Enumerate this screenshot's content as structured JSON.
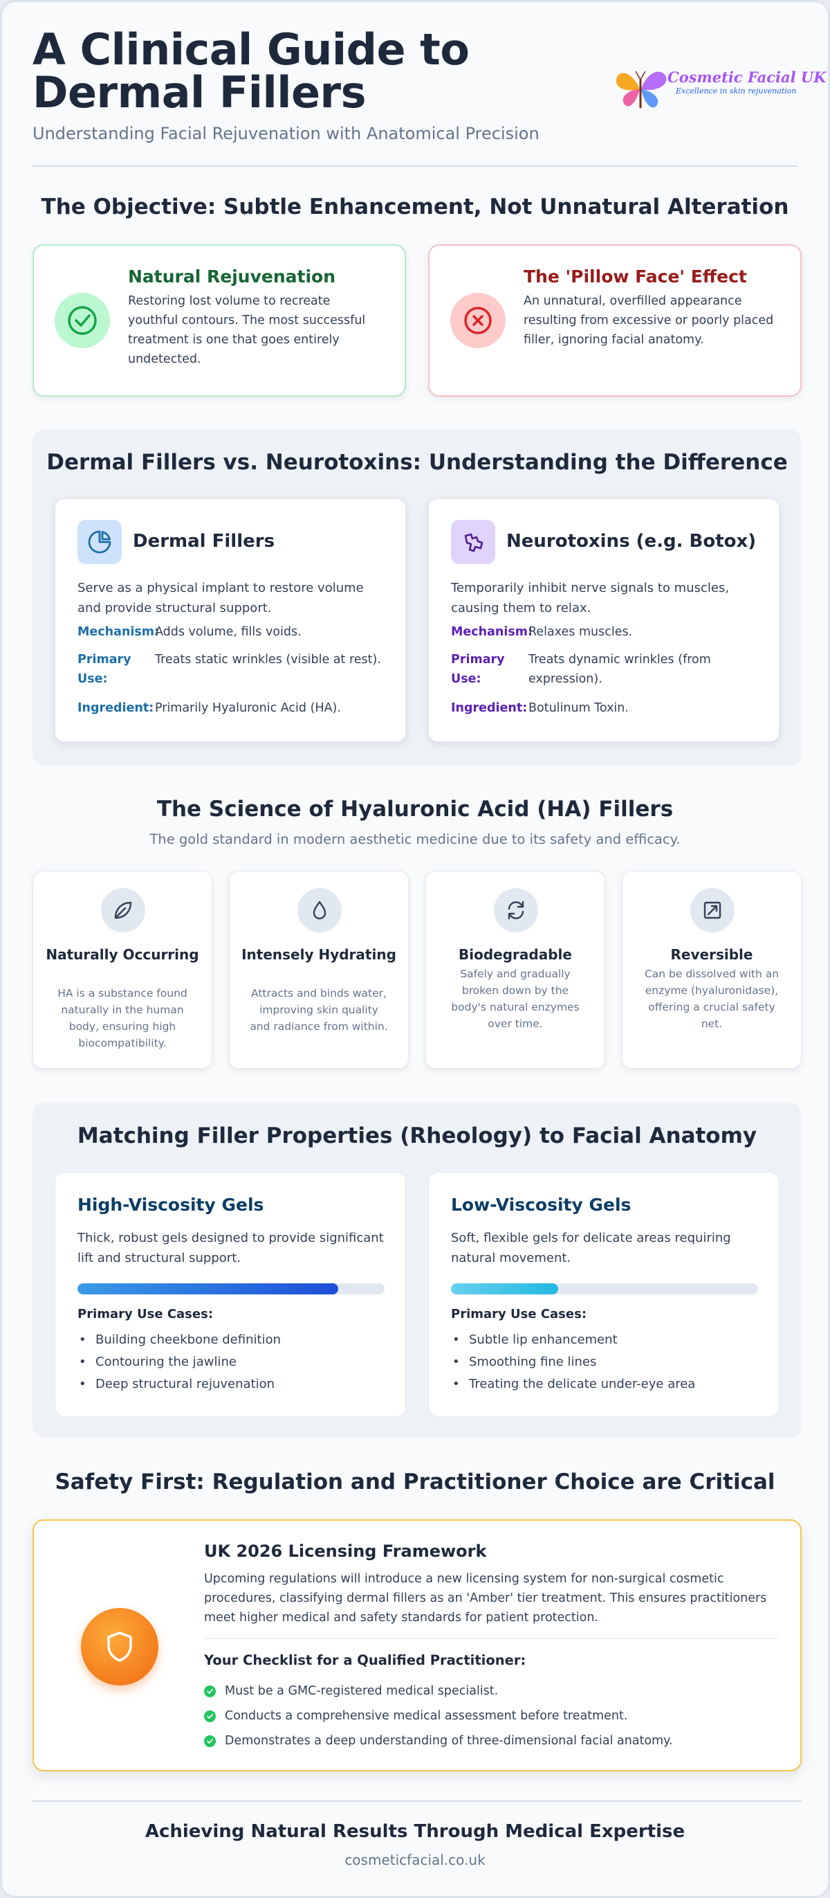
{
  "header": {
    "title": "A Clinical Guide to Dermal Fillers",
    "subtitle": "Understanding Facial Rejuvenation with Anatomical Precision",
    "logo_name": "Cosmetic Facial UK",
    "logo_tagline": "Excellence in skin rejuvenation"
  },
  "objective": {
    "title": "The Objective: Subtle Enhancement, Not Unnatural Alteration",
    "good": {
      "icon": "check-circle-icon",
      "heading": "Natural Rejuvenation",
      "text": "Restoring lost volume to recreate youthful contours. The most successful treatment is one that goes entirely undetected."
    },
    "bad": {
      "icon": "x-circle-icon",
      "heading": "The 'Pillow Face' Effect",
      "text": "An unnatural, overfilled appearance resulting from excessive or poorly placed filler, ignoring facial anatomy."
    }
  },
  "comparison": {
    "title": "Dermal Fillers vs. Neurotoxins: Understanding the Difference",
    "fillers": {
      "icon": "pie-chart-icon",
      "heading": "Dermal Fillers",
      "description": "Serve as a physical implant to restore volume and provide structural support.",
      "rows": [
        {
          "key": "Mechanism:",
          "value": "Adds volume, fills voids."
        },
        {
          "key": "Primary Use:",
          "value": "Treats static wrinkles (visible at rest)."
        },
        {
          "key": "Ingredient:",
          "value": "Primarily Hyaluronic Acid (HA)."
        }
      ]
    },
    "neurotoxins": {
      "icon": "puzzle-icon",
      "heading": "Neurotoxins (e.g. Botox)",
      "description": "Temporarily inhibit nerve signals to muscles, causing them to relax.",
      "rows": [
        {
          "key": "Mechanism:",
          "value": "Relaxes muscles."
        },
        {
          "key": "Primary Use:",
          "value": "Treats dynamic wrinkles (from expression)."
        },
        {
          "key": "Ingredient:",
          "value": "Botulinum Toxin."
        }
      ]
    }
  },
  "science": {
    "title": "The Science of Hyaluronic Acid (HA) Fillers",
    "subtitle": "The gold standard in modern aesthetic medicine due to its safety and efficacy.",
    "cards": [
      {
        "icon": "leaf-icon",
        "heading": "Naturally Occurring",
        "text": "HA is a substance found naturally in the human body, ensuring high biocompatibility."
      },
      {
        "icon": "droplet-icon",
        "heading": "Intensely Hydrating",
        "text": "Attracts and binds water, improving skin quality and radiance from within."
      },
      {
        "icon": "refresh-icon",
        "heading": "Biodegradable",
        "text": "Safely and gradually broken down by the body's natural enzymes over time."
      },
      {
        "icon": "undo-arrow-icon",
        "heading": "Reversible",
        "text": "Can be dissolved with an enzyme (hyaluronidase), offering a crucial safety net."
      }
    ]
  },
  "rheology": {
    "title": "Matching Filler Properties (Rheology) to Facial Anatomy",
    "high": {
      "heading": "High-Viscosity Gels",
      "description": "Thick, robust gels designed to provide significant lift and structural support.",
      "viscosity_fraction": 0.85,
      "uses_label": "Primary Use Cases:",
      "uses": [
        "Building cheekbone definition",
        "Contouring the jawline",
        "Deep structural rejuvenation"
      ]
    },
    "low": {
      "heading": "Low-Viscosity Gels",
      "description": "Soft, flexible gels for delicate areas requiring natural movement.",
      "viscosity_fraction": 0.35,
      "uses_label": "Primary Use Cases:",
      "uses": [
        "Subtle lip enhancement",
        "Smoothing fine lines",
        "Treating the delicate under-eye area"
      ]
    }
  },
  "safety": {
    "title": "Safety First: Regulation and Practitioner Choice are Critical",
    "icon": "shield-icon",
    "heading": "UK 2026 Licensing Framework",
    "description": "Upcoming regulations will introduce a new licensing system for non-surgical cosmetic procedures, classifying dermal fillers as an 'Amber' tier treatment. This ensures practitioners meet higher medical and safety standards for patient protection.",
    "checklist_title": "Your Checklist for a Qualified Practitioner:",
    "checklist": [
      "Must be a GMC-registered medical specialist.",
      "Conducts a comprehensive medical assessment before treatment.",
      "Demonstrates a deep understanding of three-dimensional facial anatomy."
    ]
  },
  "footer": {
    "title": "Achieving Natural Results Through Medical Expertise",
    "url": "cosmeticfacial.co.uk"
  }
}
